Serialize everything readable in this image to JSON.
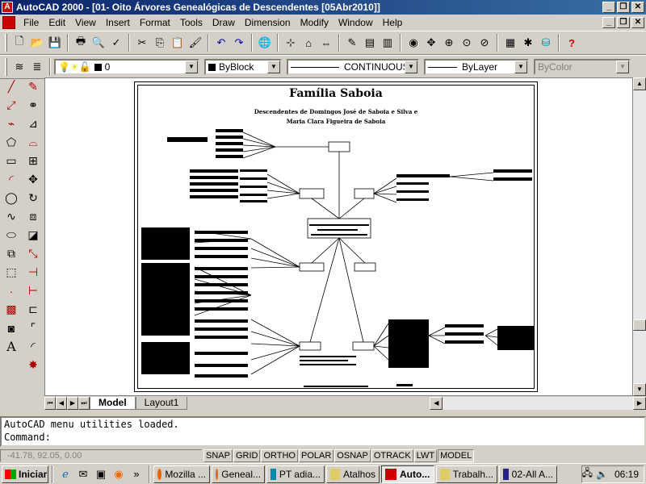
{
  "window": {
    "title": "AutoCAD 2000 - [01- Oito Árvores  Genealógicas de Descendentes  [05Abr2010]]"
  },
  "menu": [
    "File",
    "Edit",
    "View",
    "Insert",
    "Format",
    "Tools",
    "Draw",
    "Dimension",
    "Modify",
    "Window",
    "Help"
  ],
  "properties_toolbar": {
    "layer": "0",
    "color": "ByBlock",
    "linetype": "CONTINUOUS",
    "lineweight": "ByLayer",
    "plotstyle": "ByColor"
  },
  "drawing": {
    "title": "Família Saboia",
    "subtitle_line1": "Descendentes de Domingos José de Saboia e Silva e",
    "subtitle_line2": "Maria Clara Figueira de Saboia"
  },
  "tabs": [
    "Model",
    "Layout1"
  ],
  "command": {
    "line1": "AutoCAD menu utilities loaded.",
    "line2": "Command:"
  },
  "status": {
    "coords": "-41.78, 92.05, 0.00",
    "toggles": [
      "SNAP",
      "GRID",
      "ORTHO",
      "POLAR",
      "OSNAP",
      "OTRACK",
      "LWT",
      "MODEL"
    ]
  },
  "taskbar": {
    "start": "Iniciar",
    "buttons": [
      "Mozilla ...",
      "Geneal...",
      "PT adia...",
      "Atalhos",
      "Auto...",
      "Trabalh...",
      "02-All A..."
    ],
    "active_index": 4,
    "clock": "06:19"
  },
  "colors": {
    "titlebar_start": "#0a246a",
    "titlebar_end": "#3a6ea5",
    "face": "#d4d0c8"
  }
}
